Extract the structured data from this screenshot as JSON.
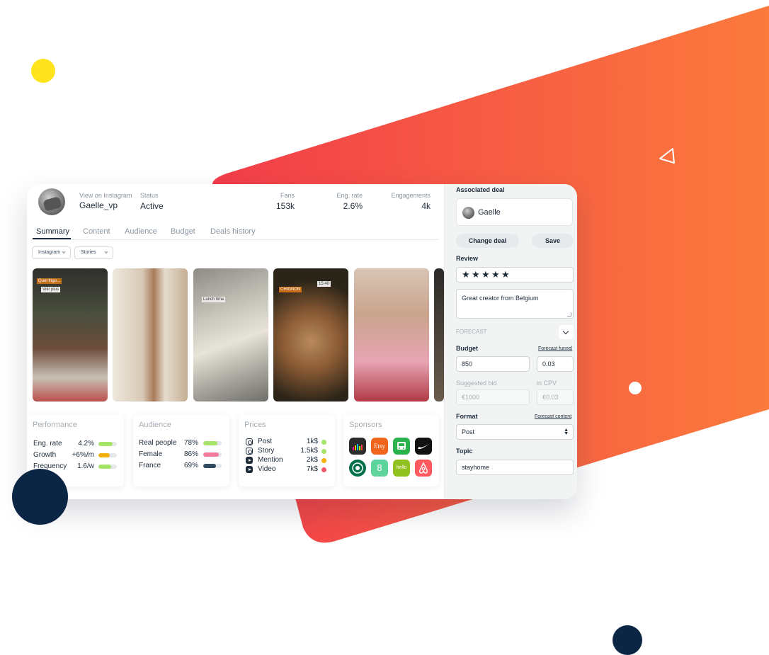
{
  "profile": {
    "handle_label": "View on Instagram",
    "handle": "Gaelle_vp",
    "status_label": "Status",
    "status": "Active",
    "fans_label": "Fans",
    "fans": "153k",
    "eng_rate_label": "Eng. rate",
    "eng_rate": "2.6%",
    "engagements_label": "Engagements",
    "engagements": "4k"
  },
  "tabs": [
    "Summary",
    "Content",
    "Audience",
    "Budget",
    "Deals history"
  ],
  "filters": {
    "platform": "Instagram",
    "format": "Stories"
  },
  "stories": {
    "s1": [
      "Quel frigo...",
      "Voir plus"
    ],
    "s3": [
      "Lunch time"
    ],
    "s4": [
      "CHIGNON",
      "15:40"
    ]
  },
  "performance": {
    "title": "Performance",
    "rows": [
      {
        "label": "Eng. rate",
        "value": "4.2%",
        "level": 0.75,
        "color": "#a6e36b"
      },
      {
        "label": "Growth",
        "value": "+6%/m",
        "level": 0.6,
        "color": "#f2b10f"
      },
      {
        "label": "Frequency",
        "value": "1.6/w",
        "level": 0.7,
        "color": "#a6e36b"
      }
    ]
  },
  "audience": {
    "title": "Audience",
    "rows": [
      {
        "label": "Real people",
        "value": "78%",
        "level": 0.78,
        "color": "#a6e36b"
      },
      {
        "label": "Female",
        "value": "86%",
        "level": 0.86,
        "color": "#f27a9a"
      },
      {
        "label": "France",
        "value": "69%",
        "level": 0.69,
        "color": "#2f4b64"
      }
    ]
  },
  "prices": {
    "title": "Prices",
    "rows": [
      {
        "label": "Post",
        "value": "1k$",
        "icon": "instagram-icon",
        "dot": "#a6e36b"
      },
      {
        "label": "Story",
        "value": "1.5k$",
        "icon": "instagram-icon",
        "dot": "#a6e36b"
      },
      {
        "label": "Mention",
        "value": "2k$",
        "icon": "youtube-icon",
        "dot": "#f2b10f"
      },
      {
        "label": "Video",
        "value": "7k$",
        "icon": "youtube-icon",
        "dot": "#f0596a"
      }
    ]
  },
  "sponsors": {
    "title": "Sponsors",
    "logos": [
      {
        "name": "deezer-logo",
        "text": "",
        "color": "#2b2b2b"
      },
      {
        "name": "etsy-logo",
        "text": "Etsy",
        "color": "#f1641e"
      },
      {
        "name": "bus-logo",
        "text": "",
        "color": "#2bb24c"
      },
      {
        "name": "nike-logo",
        "text": "",
        "color": "#111111"
      },
      {
        "name": "starbucks-logo",
        "text": "",
        "color": "#00704a"
      },
      {
        "name": "sensible-logo",
        "text": "8",
        "color": "#5ed39b"
      },
      {
        "name": "hellofresh-logo",
        "text": "hello",
        "color": "#91c11e"
      },
      {
        "name": "airbnb-logo",
        "text": "",
        "color": "#ff5a5f"
      }
    ]
  },
  "deal": {
    "associated_label": "Associated deal",
    "name": "Gaelle",
    "change_label": "Change deal",
    "save_label": "Save",
    "review_label": "Review",
    "stars": 5,
    "star_glyph": "★",
    "review_text": "Great creator from Belgium",
    "forecast_label": "FORECAST",
    "budget_label": "Budget",
    "forecast_funnel": "Forecast funnel",
    "budget_value": "850",
    "bid_value": "0.03",
    "suggested_label": "Suggested bid",
    "cpv_label": "in CPV",
    "suggested_placeholder": "€1000",
    "cpv_placeholder": "€0.03",
    "format_label": "Format",
    "forecast_content": "Forecast content",
    "format_value": "Post",
    "topic_label": "Topic",
    "topic_value": "stayhome"
  },
  "colors": {
    "accent_gradient_start": "#f23d4a",
    "accent_gradient_end": "#fb7a3c",
    "navy": "#0b2545",
    "yellow": "#ffe31c"
  }
}
